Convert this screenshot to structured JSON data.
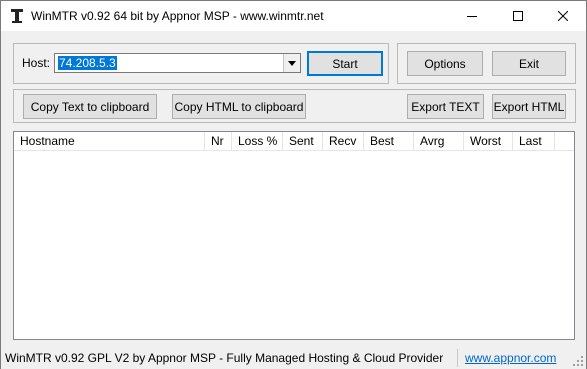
{
  "window": {
    "title": "WinMTR v0.92 64 bit by Appnor MSP - www.winmtr.net",
    "icon": "winmtr-app-icon",
    "controls": [
      "minimize-icon",
      "maximize-icon",
      "close-icon"
    ]
  },
  "host": {
    "label": "Host:",
    "value": "74.208.5.3",
    "dropdown_icon": "chevron-down-icon"
  },
  "buttons": {
    "start": "Start",
    "options": "Options",
    "exit": "Exit",
    "copy_text": "Copy Text to clipboard",
    "copy_html": "Copy HTML to clipboard",
    "export_text": "Export TEXT",
    "export_html": "Export HTML"
  },
  "table": {
    "columns": [
      "Hostname",
      "Nr",
      "Loss %",
      "Sent",
      "Recv",
      "Best",
      "Avrg",
      "Worst",
      "Last"
    ],
    "rows": []
  },
  "statusbar": {
    "text": "WinMTR v0.92 GPL V2 by Appnor MSP - Fully Managed Hosting & Cloud Provider",
    "link": "www.appnor.com"
  },
  "colors": {
    "selection": "#0078d7",
    "link": "#0066cc",
    "face": "#f0f0f0"
  }
}
